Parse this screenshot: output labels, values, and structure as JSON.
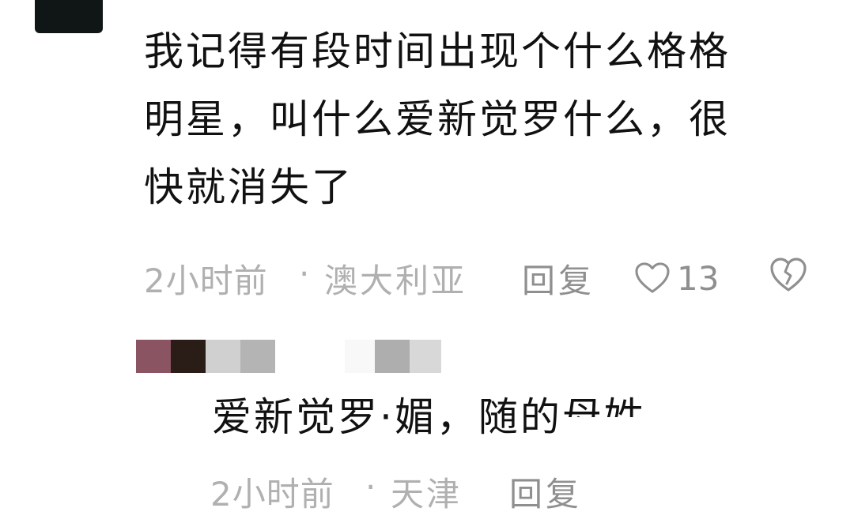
{
  "comment": {
    "text_lines": [
      "我记得有段时间出现个什么格格",
      "明星，叫什么爱新觉罗什么，很",
      "快就消失了"
    ],
    "time": "2小时前",
    "separator": "·",
    "location": "澳大利亚",
    "reply_label": "回复",
    "like_count": "13",
    "icons": {
      "like": "heart-outline-icon",
      "dislike": "broken-heart-icon"
    }
  },
  "reply": {
    "username_pixel_colors": [
      "#8a5462",
      "#2a1d17",
      "#d0d0d0",
      "#b4b4b4",
      "#f8f8f8",
      "#aeaeae",
      "#d8d8d8"
    ],
    "text_visible": "爱新觉罗·媚，随的",
    "text_cut": "母姓",
    "time": "2小时前",
    "separator": "·",
    "location": "天津",
    "reply_label": "回复"
  }
}
